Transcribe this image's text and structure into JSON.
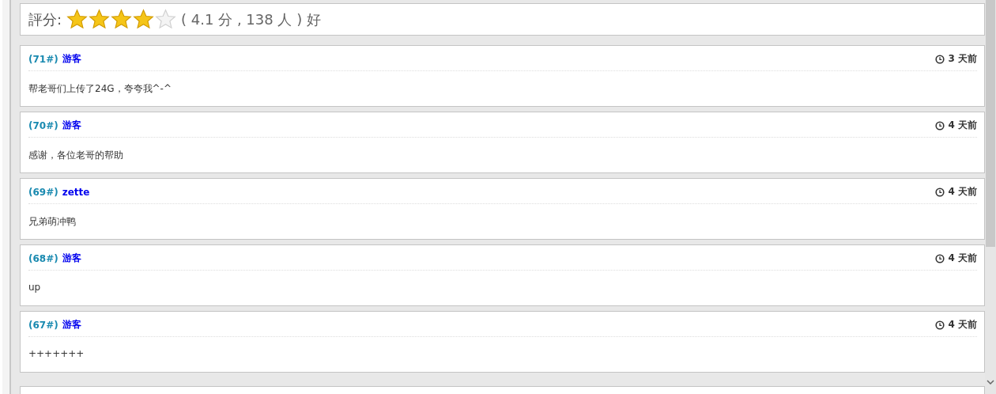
{
  "rating": {
    "label": "評分:",
    "stars": 4,
    "summary": "( 4.1 分 , 138 人 )",
    "verdict": "好"
  },
  "comments": [
    {
      "floor": "(71#)",
      "user": "游客",
      "time": "3 天前",
      "text": "帮老哥们上传了24G，夸夸我^-^"
    },
    {
      "floor": "(70#)",
      "user": "游客",
      "time": "4 天前",
      "text": "感谢，各位老哥的帮助"
    },
    {
      "floor": "(69#)",
      "user": "zette",
      "time": "4 天前",
      "text": "兄弟萌冲鸭"
    },
    {
      "floor": "(68#)",
      "user": "游客",
      "time": "4 天前",
      "text": "up"
    },
    {
      "floor": "(67#)",
      "user": "游客",
      "time": "4 天前",
      "text": "+++++++"
    }
  ]
}
